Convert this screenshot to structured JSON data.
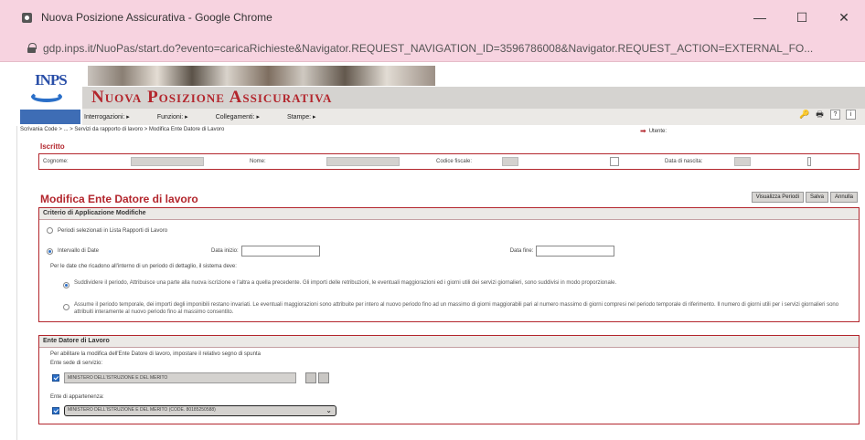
{
  "window": {
    "title": "Nuova Posizione Assicurativa - Google Chrome",
    "minimize": "—",
    "maximize": "☐",
    "close": "✕"
  },
  "address": {
    "url": "gdp.inps.it/NuoPas/start.do?evento=caricaRichieste&Navigator.REQUEST_NAVIGATION_ID=3596786008&Navigator.REQUEST_ACTION=EXTERNAL_FO..."
  },
  "app": {
    "logo_text": "INPS",
    "title": "Nuova Posizione Assicurativa",
    "menu": [
      "Interrogazioni: ▸",
      "Funzioni: ▸",
      "Collegamenti: ▸",
      "Stampe: ▸"
    ]
  },
  "breadcrumb": {
    "text": "Scrivania Code > ... > Servizi da rapporto di lavoro > Modifica Ente Datore di Lavoro",
    "utente_label": "Utente:"
  },
  "iscritto": {
    "section_title": "Iscritto",
    "cognome_label": "Cognome:",
    "nome_label": "Nome:",
    "codice_fiscale_label": "Codice fiscale:",
    "data_nascita_label": "Data di nascita:"
  },
  "modifica": {
    "title": "Modifica Ente Datore di lavoro",
    "buttons": [
      "Visualizza Periodi",
      "Salva",
      "Annulla"
    ]
  },
  "criterio": {
    "header": "Criterio di Applicazione Modifiche",
    "option1": "Periodi selezionati in Lista Rapporti di Lavoro",
    "option2": "Intervallo di Date",
    "data_inizio_label": "Data inizio:",
    "data_fine_label": "Data fine:",
    "note": "Per le date che ricadono all'interno di un periodo di dettaglio, il sistema deve:",
    "sub1": "Suddividere il periodo, Attribuisce una parte alla nuova iscrizione e l'altra a quella precedente. Gli importi delle retribuzioni, le eventuali maggiorazioni ed i giorni utili dei servizi giornalieri, sono suddivisi in modo proporzionale.",
    "sub2": "Assume il periodo temporale, dei importi degli imponibili restano invariati. Le eventuali maggiorazioni sono attribuite per intero al nuovo periodo fino ad un massimo di giorni maggiorabili pari al numero massimo di giorni compresi nel periodo temporale di riferimento. Il numero di giorni utili per i servizi giornalieri sono attribuiti interamente al nuovo periodo fino al massimo consentito."
  },
  "ente": {
    "header": "Ente Datore di Lavoro",
    "note": "Per abilitare la modifica dell'Ente Datore di lavoro, impostare il relativo segno di spunta",
    "sede_label": "Ente sede di servizio:",
    "sede_value": "MINISTERO DELL'ISTRUZIONE E DEL MERITO",
    "appartenenza_label": "Ente di appartenenza:",
    "appartenenza_value": "MINISTERO DELL'ISTRUZIONE E DEL MERITO (CODE. 80185250588)"
  },
  "colors": {
    "accent": "#b3262d",
    "chrome_bar": "#f7d3e0",
    "check_blue": "#2a6fc8"
  }
}
